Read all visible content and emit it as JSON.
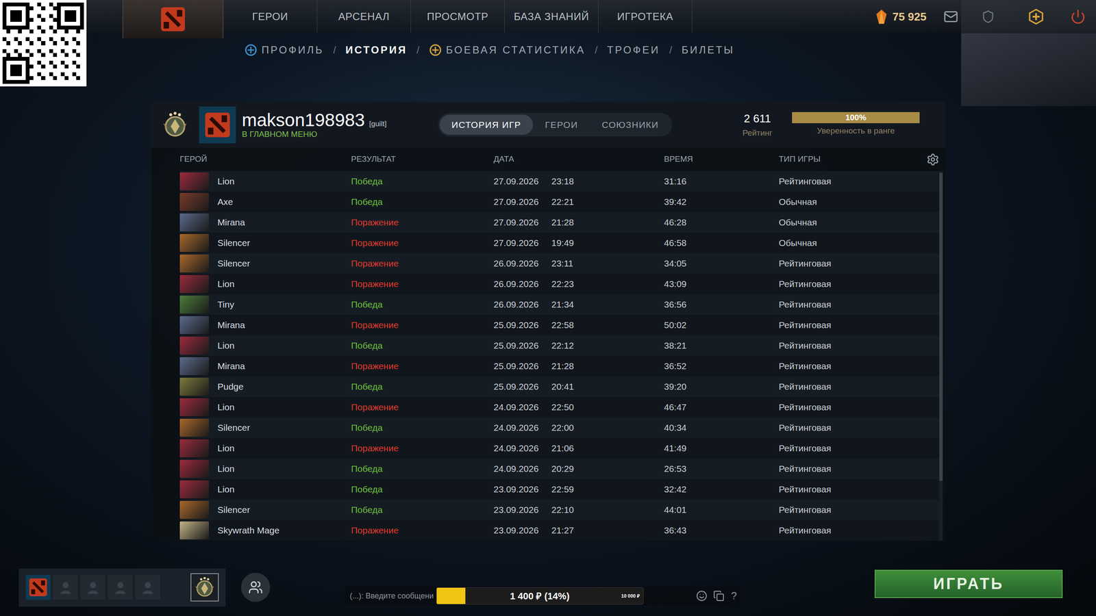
{
  "nav": {
    "items": [
      "ГЕРОИ",
      "АРСЕНАЛ",
      "ПРОСМОТР",
      "БАЗА ЗНАНИЙ",
      "ИГРОТЕКА"
    ],
    "currency": "75 925"
  },
  "subnav": [
    {
      "label": "ПРОФИЛЬ",
      "selected": false,
      "kind": "icon"
    },
    {
      "label": "ИСТОРИЯ",
      "selected": true,
      "kind": "plain"
    },
    {
      "label": "БОЕВАЯ СТАТИСТИКА",
      "selected": false,
      "kind": "icon"
    },
    {
      "label": "ТРОФЕИ",
      "selected": false,
      "kind": "plain"
    },
    {
      "label": "БИЛЕТЫ",
      "selected": false,
      "kind": "plain"
    }
  ],
  "profile": {
    "name": "makson198983",
    "tag": "[guilt]",
    "status": "В ГЛАВНОМ МЕНЮ",
    "tabs": [
      {
        "label": "ИСТОРИЯ ИГР",
        "selected": true
      },
      {
        "label": "ГЕРОИ",
        "selected": false
      },
      {
        "label": "СОЮЗНИКИ",
        "selected": false
      }
    ],
    "rating": "2 611",
    "rating_label": "Рейтинг",
    "confidence": {
      "reading": "100%",
      "level": 1,
      "label": "Уверенность в ранге"
    }
  },
  "table": {
    "columns": [
      "ГЕРОЙ",
      "РЕЗУЛЬТАТ",
      "ДАТА",
      "ВРЕМЯ",
      "ТИП ИГРЫ"
    ],
    "rows": [
      {
        "hero": "Lion",
        "color": "#9b2b3c",
        "result": "Победа",
        "win": true,
        "date": "27.09.2026",
        "time": "23:18",
        "duration": "31:16",
        "type": "Рейтинговая"
      },
      {
        "hero": "Axe",
        "color": "#7a3b2a",
        "result": "Победа",
        "win": true,
        "date": "27.09.2026",
        "time": "22:21",
        "duration": "39:42",
        "type": "Обычная"
      },
      {
        "hero": "Mirana",
        "color": "#5b6b8c",
        "result": "Поражение",
        "win": false,
        "date": "27.09.2026",
        "time": "21:28",
        "duration": "46:28",
        "type": "Обычная"
      },
      {
        "hero": "Silencer",
        "color": "#a8682c",
        "result": "Поражение",
        "win": false,
        "date": "27.09.2026",
        "time": "19:49",
        "duration": "46:58",
        "type": "Обычная"
      },
      {
        "hero": "Silencer",
        "color": "#a8682c",
        "result": "Поражение",
        "win": false,
        "date": "26.09.2026",
        "time": "23:11",
        "duration": "34:05",
        "type": "Рейтинговая"
      },
      {
        "hero": "Lion",
        "color": "#9b2b3c",
        "result": "Поражение",
        "win": false,
        "date": "26.09.2026",
        "time": "22:23",
        "duration": "43:09",
        "type": "Рейтинговая"
      },
      {
        "hero": "Tiny",
        "color": "#4d7c3a",
        "result": "Победа",
        "win": true,
        "date": "26.09.2026",
        "time": "21:34",
        "duration": "36:56",
        "type": "Рейтинговая"
      },
      {
        "hero": "Mirana",
        "color": "#5b6b8c",
        "result": "Поражение",
        "win": false,
        "date": "25.09.2026",
        "time": "22:58",
        "duration": "50:02",
        "type": "Рейтинговая"
      },
      {
        "hero": "Lion",
        "color": "#9b2b3c",
        "result": "Победа",
        "win": true,
        "date": "25.09.2026",
        "time": "22:12",
        "duration": "38:21",
        "type": "Рейтинговая"
      },
      {
        "hero": "Mirana",
        "color": "#5b6b8c",
        "result": "Поражение",
        "win": false,
        "date": "25.09.2026",
        "time": "21:28",
        "duration": "36:52",
        "type": "Рейтинговая"
      },
      {
        "hero": "Pudge",
        "color": "#7d7a3c",
        "result": "Победа",
        "win": true,
        "date": "25.09.2026",
        "time": "20:41",
        "duration": "39:20",
        "type": "Рейтинговая"
      },
      {
        "hero": "Lion",
        "color": "#9b2b3c",
        "result": "Поражение",
        "win": false,
        "date": "24.09.2026",
        "time": "22:50",
        "duration": "46:47",
        "type": "Рейтинговая"
      },
      {
        "hero": "Silencer",
        "color": "#a8682c",
        "result": "Победа",
        "win": true,
        "date": "24.09.2026",
        "time": "22:00",
        "duration": "40:34",
        "type": "Рейтинговая"
      },
      {
        "hero": "Lion",
        "color": "#9b2b3c",
        "result": "Поражение",
        "win": false,
        "date": "24.09.2026",
        "time": "21:06",
        "duration": "41:49",
        "type": "Рейтинговая"
      },
      {
        "hero": "Lion",
        "color": "#9b2b3c",
        "result": "Победа",
        "win": true,
        "date": "24.09.2026",
        "time": "20:29",
        "duration": "26:53",
        "type": "Рейтинговая"
      },
      {
        "hero": "Lion",
        "color": "#9b2b3c",
        "result": "Победа",
        "win": true,
        "date": "23.09.2026",
        "time": "22:59",
        "duration": "32:42",
        "type": "Рейтинговая"
      },
      {
        "hero": "Silencer",
        "color": "#a8682c",
        "result": "Победа",
        "win": true,
        "date": "23.09.2026",
        "time": "22:10",
        "duration": "44:01",
        "type": "Рейтинговая"
      },
      {
        "hero": "Skywrath Mage",
        "color": "#c2b287",
        "result": "Поражение",
        "win": false,
        "date": "23.09.2026",
        "time": "21:27",
        "duration": "36:43",
        "type": "Рейтинговая"
      }
    ]
  },
  "party": {
    "slots": [
      {
        "filled": true
      },
      {
        "filled": false
      },
      {
        "filled": false
      },
      {
        "filled": false
      },
      {
        "filled": false
      }
    ]
  },
  "chat": {
    "placeholder": "(...): Введите сообщени",
    "help": "?"
  },
  "donation": {
    "reading": "1 400 ₽ (14%)",
    "goal": "10 000 ₽",
    "level": 0.14
  },
  "play_button": "ИГРАТЬ"
}
